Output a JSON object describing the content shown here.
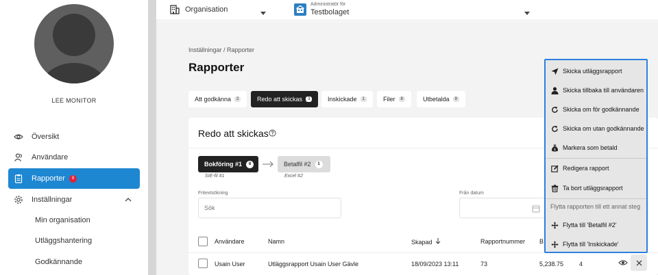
{
  "sidebar": {
    "user_name": "LEE MONITOR",
    "items": [
      {
        "label": "Översikt",
        "icon": "eye-icon"
      },
      {
        "label": "Användare",
        "icon": "users-icon"
      },
      {
        "label": "Rapporter",
        "icon": "clipboard-icon",
        "badge": "9",
        "active": true
      },
      {
        "label": "Inställningar",
        "icon": "gear-icon"
      }
    ],
    "sub_items": [
      "Min organisation",
      "Utläggshantering",
      "Godkännande"
    ]
  },
  "topbar": {
    "org_label": "Organisation",
    "admin_small": "Administratör för",
    "admin_name": "Testbolaget"
  },
  "page": {
    "breadcrumb": "Inställningar / Rapporter",
    "title": "Rapporter"
  },
  "tabs": [
    {
      "label": "Att godkänna",
      "count": "2"
    },
    {
      "label": "Redo att skickas",
      "count": "3",
      "active": true
    },
    {
      "label": "Inskickade",
      "count": "1"
    },
    {
      "label": "Filer",
      "count": "8"
    },
    {
      "label": "Utbetalda",
      "count": "9"
    }
  ],
  "card": {
    "title": "Redo att skickas",
    "steps": [
      {
        "label": "Bokföring #1",
        "count": "8",
        "sub": "SIE-fil #1"
      },
      {
        "label": "Betalfil #2",
        "count": "1",
        "sub": "Excel #2"
      }
    ],
    "search_label": "Fritextsökning",
    "search_placeholder": "Sök",
    "date_label": "Från datum"
  },
  "table": {
    "headers": {
      "user": "Användare",
      "name": "Namn",
      "created": "Skapad",
      "number": "Rapportnummer",
      "amount_partial": "B"
    },
    "rows": [
      {
        "user": "Usain User",
        "name": "Utläggsrapport Usain User Gävle",
        "created": "18/09/2023 13:11",
        "number": "73",
        "amount": "5,238.75",
        "count": "4"
      }
    ]
  },
  "menu": {
    "items": [
      {
        "label": "Skicka utläggsrapport",
        "icon": "send-icon"
      },
      {
        "label": "Skicka tillbaka till användaren",
        "icon": "user-icon"
      },
      {
        "label": "Skicka om för godkännande",
        "icon": "refresh-icon"
      },
      {
        "label": "Skicka om utan godkännande",
        "icon": "refresh-icon"
      },
      {
        "label": "Markera som betald",
        "icon": "money-bag-icon"
      },
      {
        "label": "Redigera rapport",
        "icon": "edit-icon"
      },
      {
        "label": "Ta bort utläggsrapport",
        "icon": "trash-icon"
      }
    ],
    "move_header": "Flytta rapporten till ett annat steg",
    "move_items": [
      {
        "label": "Flytta till 'Betalfil #2'",
        "icon": "move-icon"
      },
      {
        "label": "Flytta till 'Inskickade'",
        "icon": "move-icon"
      }
    ]
  },
  "colors": {
    "accent": "#1e87d2",
    "badge": "#e0233c",
    "menu_border": "#2c7fe0"
  }
}
